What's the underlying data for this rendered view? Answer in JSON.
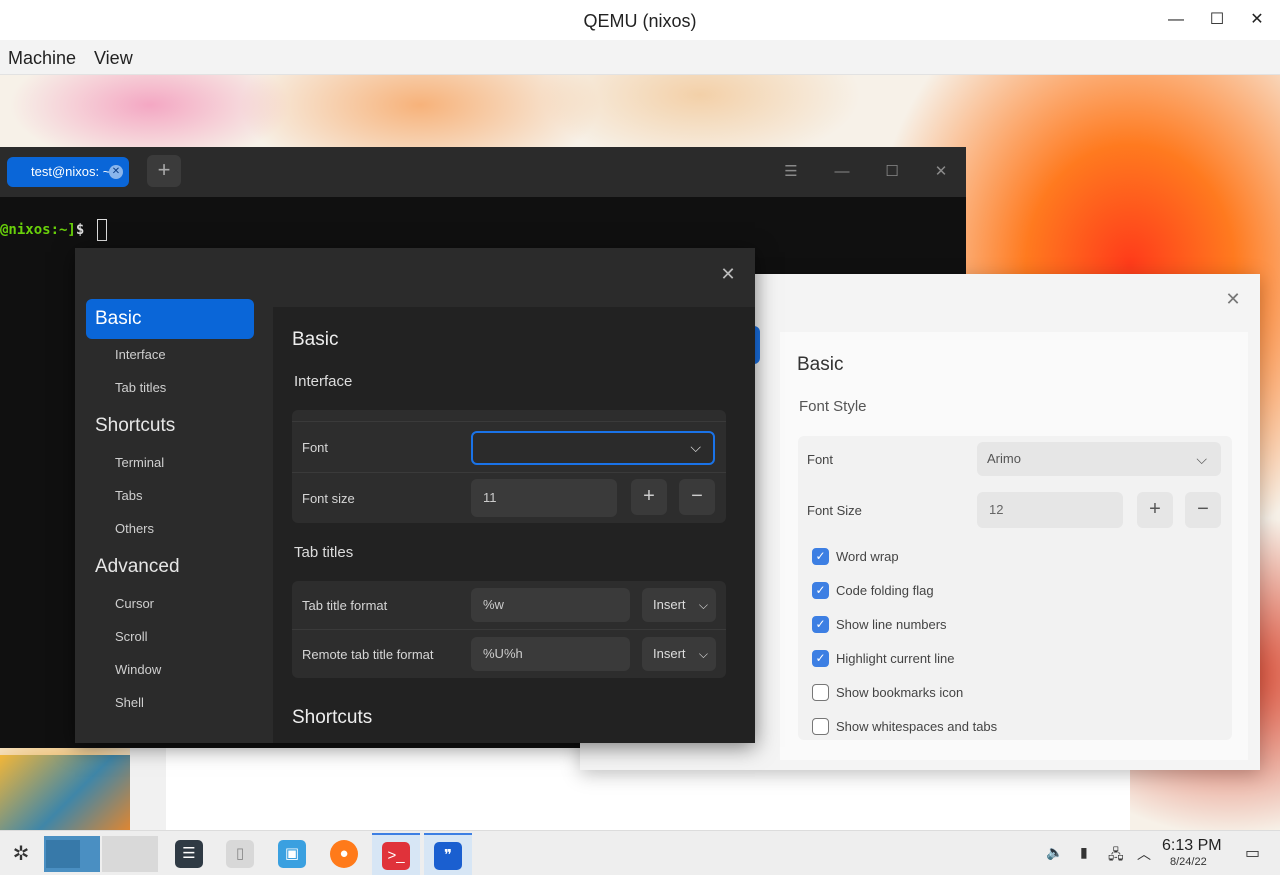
{
  "window": {
    "title": "QEMU (nixos)"
  },
  "menubar": {
    "items": [
      "Machine",
      "View"
    ]
  },
  "terminal": {
    "tab_label": "test@nixos: ~",
    "prompt_host": "@nixos:~]",
    "prompt_symbol": "$"
  },
  "dark_dialog": {
    "nav": {
      "selected": "Basic",
      "groups": [
        {
          "label": "Shortcuts"
        },
        {
          "label": "Advanced"
        }
      ],
      "items": [
        "Interface",
        "Tab titles",
        "Terminal",
        "Tabs",
        "Others",
        "Cursor",
        "Scroll",
        "Window",
        "Shell"
      ]
    },
    "heading": "Basic",
    "interface_section": "Interface",
    "font_label": "Font",
    "font_value": "",
    "font_size_label": "Font size",
    "font_size_value": "11",
    "tab_titles_section": "Tab titles",
    "tab_title_format_label": "Tab title format",
    "tab_title_format_value": "%w",
    "remote_tab_title_format_label": "Remote tab title format",
    "remote_tab_title_format_value": "%U%h",
    "insert_label": "Insert",
    "shortcuts_section": "Shortcuts"
  },
  "light_dialog": {
    "heading": "Basic",
    "section": "Font Style",
    "font_label": "Font",
    "font_value": "Arimo",
    "font_size_label": "Font Size",
    "font_size_value": "12",
    "checkboxes": [
      {
        "label": "Word wrap",
        "checked": true
      },
      {
        "label": "Code folding flag",
        "checked": true
      },
      {
        "label": "Show line numbers",
        "checked": true
      },
      {
        "label": "Highlight current line",
        "checked": true
      },
      {
        "label": "Show bookmarks icon",
        "checked": false
      },
      {
        "label": "Show whitespaces and tabs",
        "checked": false
      }
    ]
  },
  "taskbar": {
    "time": "6:13 PM",
    "date": "8/24/22",
    "tasks": [
      "settings-icon",
      "files-icon",
      "archive-icon",
      "firefox-icon",
      "terminal-icon",
      "editor-icon"
    ],
    "colors": {
      "accent": "#1a73e8",
      "terminal_task": "#e0323a",
      "editor_task": "#1a5fd0",
      "firefox": "#ff7a1a"
    }
  },
  "icons": {
    "plus": "+",
    "minus": "−",
    "close": "✕",
    "chevron": "⌵",
    "check": "✓"
  }
}
